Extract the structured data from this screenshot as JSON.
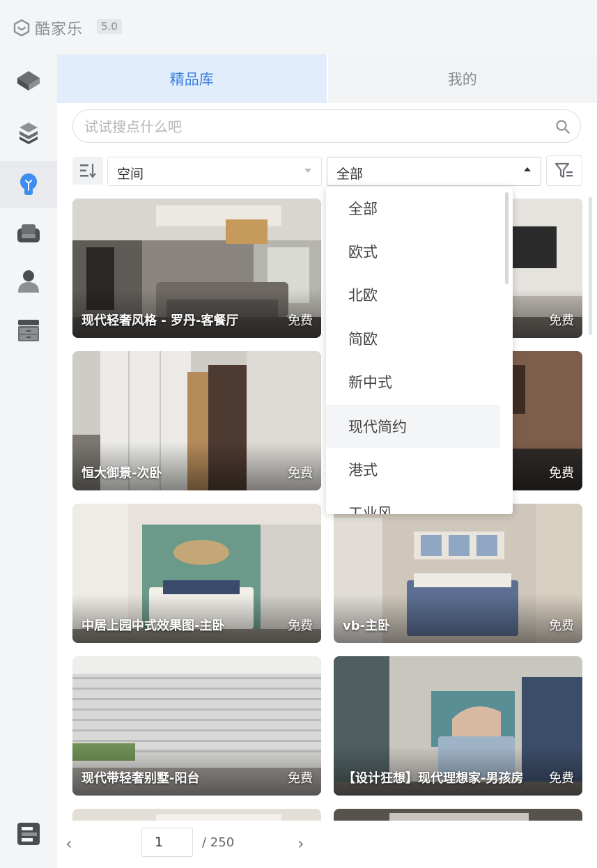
{
  "app": {
    "name": "酷家乐",
    "version": "5.0"
  },
  "sidebar": {
    "items": [
      {
        "icon": "model-cube-icon"
      },
      {
        "icon": "layers-icon"
      },
      {
        "icon": "inspiration-bulb-icon",
        "active": true
      },
      {
        "icon": "sofa-icon"
      },
      {
        "icon": "person-icon"
      },
      {
        "icon": "cabinet-icon"
      },
      {
        "icon": "panel-toggle-icon"
      }
    ]
  },
  "tabs": [
    {
      "label": "精品库",
      "active": true
    },
    {
      "label": "我的",
      "active": false
    }
  ],
  "search": {
    "placeholder": "试试搜点什么吧"
  },
  "filters": {
    "space": {
      "value": "空间"
    },
    "style": {
      "value": "全部",
      "open": true
    }
  },
  "style_options": [
    "全部",
    "欧式",
    "北欧",
    "简欧",
    "新中式",
    "现代简约",
    "港式",
    "工业风"
  ],
  "hovered_option": "现代简约",
  "cards": [
    {
      "title": "现代轻奢风格 - 罗丹-客餐厅",
      "price": "免费",
      "theme": "living"
    },
    {
      "title": "",
      "price": "免费",
      "theme": "tv"
    },
    {
      "title": "恒大御景-次卧",
      "price": "免费",
      "theme": "wardrobe"
    },
    {
      "title": "",
      "price": "免费",
      "theme": "wood"
    },
    {
      "title": "中居上园中式效果图-主卧",
      "price": "免费",
      "theme": "green"
    },
    {
      "title": "vb-主卧",
      "price": "免费",
      "theme": "bedroom"
    },
    {
      "title": "现代带轻奢别墅-阳台",
      "price": "免费",
      "theme": "balcony"
    },
    {
      "title": "【设计狂想】现代理想家-男孩房",
      "price": "免费",
      "theme": "boy"
    }
  ],
  "pagination": {
    "current": "1",
    "total": "/ 250"
  }
}
